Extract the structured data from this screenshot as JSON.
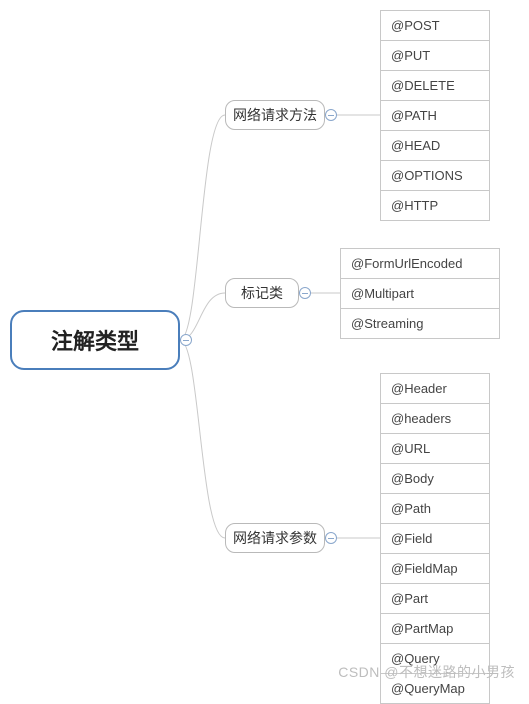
{
  "root": {
    "label": "注解类型"
  },
  "branches": [
    {
      "id": "methods",
      "label": "网络请求方法",
      "leaves": [
        "@POST",
        "@PUT",
        "@DELETE",
        "@PATH",
        "@HEAD",
        "@OPTIONS",
        "@HTTP"
      ]
    },
    {
      "id": "markers",
      "label": "标记类",
      "leaves": [
        "@FormUrlEncoded",
        "@Multipart",
        "@Streaming"
      ]
    },
    {
      "id": "params",
      "label": "网络请求参数",
      "leaves": [
        "@Header",
        "@headers",
        "@URL",
        "@Body",
        "@Path",
        "@Field",
        "@FieldMap",
        "@Part",
        "@PartMap",
        "@Query",
        "@QueryMap"
      ]
    }
  ],
  "watermark": "CSDN @不想迷路的小男孩",
  "colors": {
    "rootBorder": "#4a7ebb",
    "line": "#c9c9c9"
  }
}
